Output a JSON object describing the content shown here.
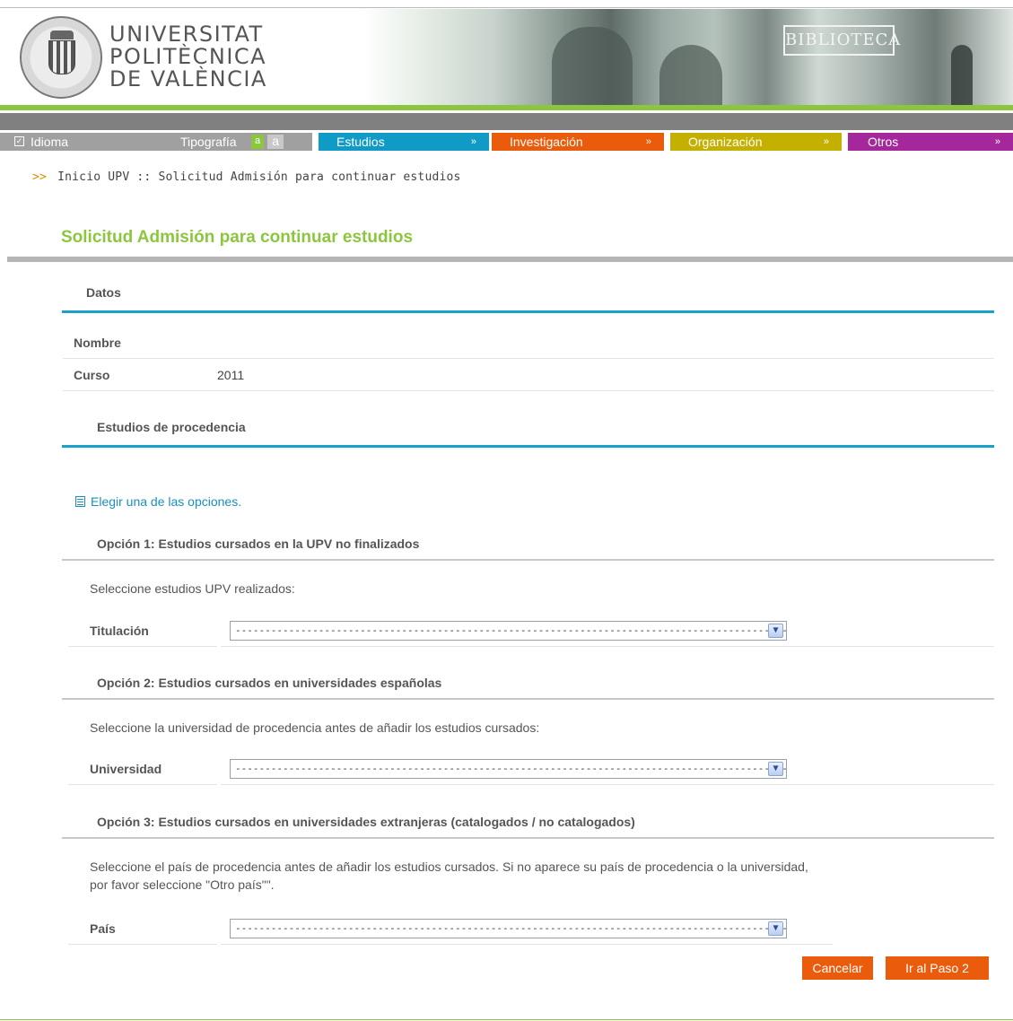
{
  "header": {
    "logo_line1": "UNIVERSITAT",
    "logo_line2": "POLITÈCNICA",
    "logo_line3": "DE VALÈNCIA",
    "banner_label": "BIBLIOTECA"
  },
  "nav": {
    "idioma": "Idioma",
    "tipografia": "Tipografía",
    "tipo_small": "a",
    "tipo_large": "a",
    "estudios": "Estudios",
    "investigacion": "Investigación",
    "organizacion": "Organización",
    "otros": "Otros",
    "chevron": "»"
  },
  "breadcrumb": {
    "arrows": ">>",
    "text": "Inicio UPV :: Solicitud Admisión para continuar estudios"
  },
  "page_title": "Solicitud Admisión para continuar estudios",
  "datos": {
    "heading": "Datos",
    "nombre_label": "Nombre",
    "curso_label": "Curso",
    "curso_value": "2011"
  },
  "procedencia": {
    "heading": "Estudios de procedencia",
    "hint": "Elegir una de las opciones."
  },
  "opcion1": {
    "heading": "Opción 1: Estudios cursados en la UPV no finalizados",
    "text": "Seleccione estudios UPV realizados:",
    "label": "Titulación",
    "select_value": "------------------------------------------------------------------------------------------------"
  },
  "opcion2": {
    "heading": "Opción 2: Estudios cursados en universidades españolas",
    "text": "Seleccione la universidad de procedencia antes de añadir los estudios cursados:",
    "label": "Universidad",
    "select_value": "------------------------------------------------------------------------------------------------"
  },
  "opcion3": {
    "heading": "Opción 3: Estudios cursados en universidades extranjeras (catalogados / no catalogados)",
    "text_line1": "Seleccione el país de procedencia antes de añadir los estudios cursados. Si no aparece su país de procedencia o la universidad,",
    "text_line2": "por favor seleccione \"Otro país\"\".",
    "label": "País",
    "select_value": "------------------------------------------------------------------------------------------------"
  },
  "buttons": {
    "cancel": "Cancelar",
    "next": "Ir al Paso 2"
  },
  "colors": {
    "green": "#8cc63f",
    "estudios": "#0f9bc6",
    "investigacion": "#ea5b0c",
    "organizacion": "#c4b000",
    "otros": "#a4279c",
    "button": "#ea5b0c"
  }
}
